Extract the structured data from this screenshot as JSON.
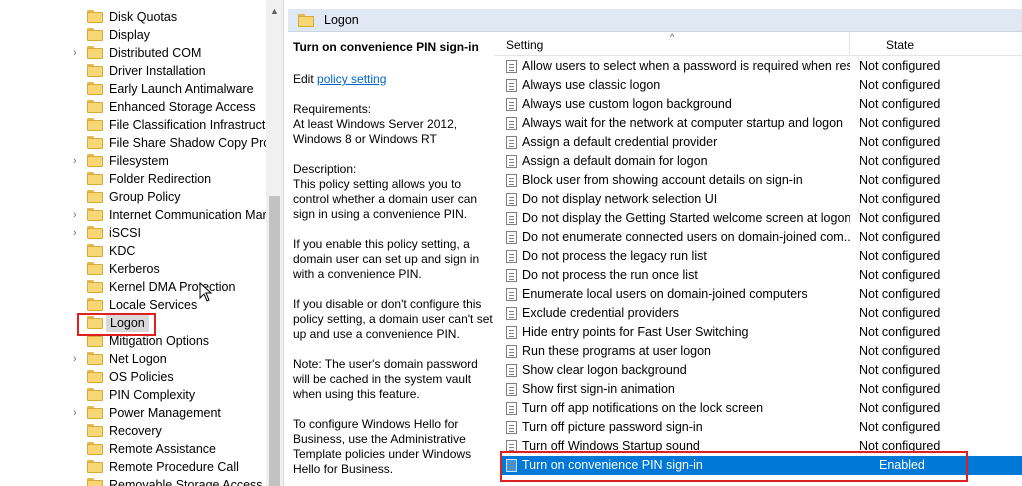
{
  "tree": {
    "items": [
      {
        "label": "Disk Quotas",
        "expandable": false
      },
      {
        "label": "Display",
        "expandable": false
      },
      {
        "label": "Distributed COM",
        "expandable": true
      },
      {
        "label": "Driver Installation",
        "expandable": false
      },
      {
        "label": "Early Launch Antimalware",
        "expandable": false
      },
      {
        "label": "Enhanced Storage Access",
        "expandable": false
      },
      {
        "label": "File Classification Infrastructu",
        "expandable": false
      },
      {
        "label": "File Share Shadow Copy Provi",
        "expandable": false
      },
      {
        "label": "Filesystem",
        "expandable": true
      },
      {
        "label": "Folder Redirection",
        "expandable": false
      },
      {
        "label": "Group Policy",
        "expandable": false
      },
      {
        "label": "Internet Communication Mar",
        "expandable": true
      },
      {
        "label": "iSCSI",
        "expandable": true
      },
      {
        "label": "KDC",
        "expandable": false
      },
      {
        "label": "Kerberos",
        "expandable": false
      },
      {
        "label": "Kernel DMA Protection",
        "expandable": false
      },
      {
        "label": "Locale Services",
        "expandable": false
      },
      {
        "label": "Logon",
        "expandable": false,
        "selected": true
      },
      {
        "label": "Mitigation Options",
        "expandable": false
      },
      {
        "label": "Net Logon",
        "expandable": true
      },
      {
        "label": "OS Policies",
        "expandable": false
      },
      {
        "label": "PIN Complexity",
        "expandable": false
      },
      {
        "label": "Power Management",
        "expandable": true
      },
      {
        "label": "Recovery",
        "expandable": false
      },
      {
        "label": "Remote Assistance",
        "expandable": false
      },
      {
        "label": "Remote Procedure Call",
        "expandable": false
      },
      {
        "label": "Removable Storage Access",
        "expandable": false
      }
    ]
  },
  "header": {
    "title": "Logon"
  },
  "description": {
    "title": "Turn on convenience PIN sign-in",
    "edit_prefix": "Edit",
    "edit_link": "policy setting",
    "paragraphs": [
      [
        "Requirements:",
        "At least Windows Server 2012,",
        "Windows 8 or Windows RT"
      ],
      [
        "Description:",
        "This policy setting allows you to",
        "control whether a domain user can",
        "sign in using a convenience PIN."
      ],
      [
        "If you enable this policy setting, a",
        "domain user can set up and sign in",
        "with a convenience PIN."
      ],
      [
        "If you disable or don't configure this",
        "policy setting, a domain user can't set",
        "up and use a convenience PIN."
      ],
      [
        "Note: The user's domain password",
        "will be cached in the system vault",
        "when using this feature."
      ],
      [
        "To configure Windows Hello for",
        "Business, use the Administrative",
        "Template policies under Windows",
        "Hello for Business."
      ]
    ]
  },
  "list": {
    "columns": {
      "setting": "Setting",
      "state": "State"
    },
    "rows": [
      {
        "name": "Allow users to select when a password is required when resu...",
        "state": "Not configured"
      },
      {
        "name": "Always use classic logon",
        "state": "Not configured"
      },
      {
        "name": "Always use custom logon background",
        "state": "Not configured"
      },
      {
        "name": "Always wait for the network at computer startup and logon",
        "state": "Not configured"
      },
      {
        "name": "Assign a default credential provider",
        "state": "Not configured"
      },
      {
        "name": "Assign a default domain for logon",
        "state": "Not configured"
      },
      {
        "name": "Block user from showing account details on sign-in",
        "state": "Not configured"
      },
      {
        "name": "Do not display network selection UI",
        "state": "Not configured"
      },
      {
        "name": "Do not display the Getting Started welcome screen at logon",
        "state": "Not configured"
      },
      {
        "name": "Do not enumerate connected users on domain-joined com...",
        "state": "Not configured"
      },
      {
        "name": "Do not process the legacy run list",
        "state": "Not configured"
      },
      {
        "name": "Do not process the run once list",
        "state": "Not configured"
      },
      {
        "name": "Enumerate local users on domain-joined computers",
        "state": "Not configured"
      },
      {
        "name": "Exclude credential providers",
        "state": "Not configured"
      },
      {
        "name": "Hide entry points for Fast User Switching",
        "state": "Not configured"
      },
      {
        "name": "Run these programs at user logon",
        "state": "Not configured"
      },
      {
        "name": "Show clear logon background",
        "state": "Not configured"
      },
      {
        "name": "Show first sign-in animation",
        "state": "Not configured"
      },
      {
        "name": "Turn off app notifications on the lock screen",
        "state": "Not configured"
      },
      {
        "name": "Turn off picture password sign-in",
        "state": "Not configured"
      },
      {
        "name": "Turn off Windows Startup sound",
        "state": "Not configured"
      },
      {
        "name": "Turn on convenience PIN sign-in",
        "state": "Enabled",
        "selected": true
      }
    ]
  },
  "colors": {
    "selection": "#0078d7",
    "annotation": "#e02020",
    "header_bg": "#dfe8f3",
    "link": "#0066cc"
  }
}
